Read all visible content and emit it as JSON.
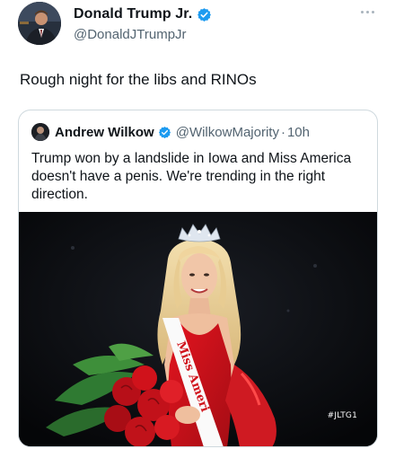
{
  "tweet": {
    "author": {
      "display_name": "Donald Trump Jr.",
      "handle": "@DonaldJTrumpJr",
      "verified": true,
      "avatar_icon": "profile-photo-avatar"
    },
    "text": "Rough night for the libs and RINOs",
    "more_icon": "more-dots-icon"
  },
  "quote": {
    "author": {
      "display_name": "Andrew Wilkow",
      "handle": "@WilkowMajority",
      "separator": "·",
      "time": "10h",
      "verified": true
    },
    "text": "Trump won by a landslide in Iowa and Miss America doesn't have a penis. We're trending in the right direction.",
    "media": {
      "description_icon": "photo-media",
      "sash_text": "Miss Ameri",
      "watermark": "#JLTG1"
    }
  },
  "colors": {
    "verified_blue": "#1d9bf0",
    "text_primary": "#0f1419",
    "text_secondary": "#536471",
    "border": "#cfd9de",
    "dress_red": "#d0121b"
  }
}
